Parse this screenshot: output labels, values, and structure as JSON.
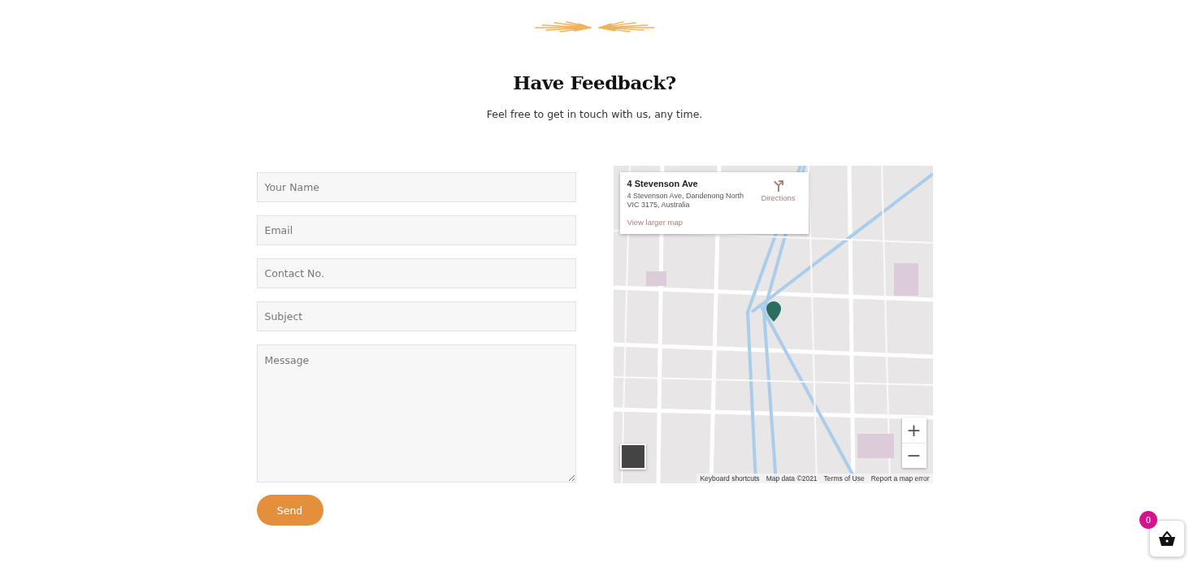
{
  "header": {
    "title": "Have Feedback?",
    "subtitle": "Feel free to get in touch with us, any time."
  },
  "form": {
    "fields": [
      {
        "kind": "input",
        "placeholder": "Your Name"
      },
      {
        "kind": "input",
        "placeholder": "Email"
      },
      {
        "kind": "input",
        "placeholder": "Contact No."
      },
      {
        "kind": "input",
        "placeholder": "Subject"
      },
      {
        "kind": "textarea",
        "placeholder": "Message"
      }
    ],
    "submit": "Send"
  },
  "map": {
    "card": {
      "title": "4 Stevenson Ave",
      "address": "4 Stevenson Ave, Dandenong North VIC 3175, Australia",
      "directions": "Directions",
      "link": "View larger map"
    },
    "zoom": [
      "+",
      "−"
    ],
    "attribution": [
      "Keyboard shortcuts",
      "Map data ©2021",
      "Terms of Use",
      "Report a map error"
    ]
  },
  "cart": {
    "count": "0"
  }
}
